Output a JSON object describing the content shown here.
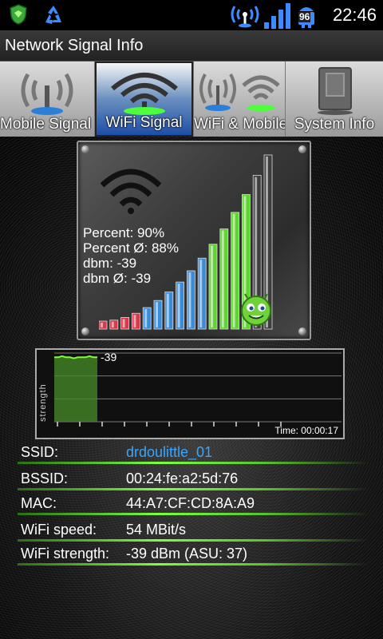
{
  "status_bar": {
    "time": "22:46",
    "battery_level": "96",
    "icons": [
      "shield-icon",
      "recycle-icon",
      "antenna-icon",
      "signal-bars-icon",
      "android-battery-icon"
    ]
  },
  "app": {
    "title": "Network Signal Info"
  },
  "tabs": [
    {
      "label": "Mobile Signal",
      "icon": "antenna-icon",
      "active": false
    },
    {
      "label": "WiFi Signal",
      "icon": "wifi-icon",
      "active": true
    },
    {
      "label": "WiFi & Mobile",
      "icon": "antenna-wifi-icon",
      "active": false
    },
    {
      "label": "System Info",
      "icon": "phone-icon",
      "active": false
    }
  ],
  "signal": {
    "percent": "Percent: 90%",
    "percent_avg": "Percent Ø: 88%",
    "dbm": "dbm: -39",
    "dbm_avg": "dbm Ø: -39",
    "level_fraction": 0.9,
    "bar_count": 16
  },
  "chart_data": {
    "type": "line",
    "ylabel": "strength",
    "value_label": "-39",
    "time_label": "Time: 00:00:17",
    "series": [
      {
        "values": [
          -39,
          -39,
          -38,
          -39,
          -39,
          -40,
          -39,
          -39,
          -39,
          -38,
          -39,
          -39
        ]
      }
    ]
  },
  "info": {
    "rows": [
      {
        "label": "SSID:",
        "value": "drdoulittle_01"
      },
      {
        "label": "BSSID:",
        "value": "00:24:fe:a2:5d:76"
      },
      {
        "label": "MAC:",
        "value": "44:A7:CF:CD:8A:A9"
      },
      {
        "label": "WiFi speed:",
        "value": "54 MBit/s"
      },
      {
        "label": "WiFi strength:",
        "value": "-39 dBm (ASU: 37)"
      }
    ]
  },
  "colors": {
    "accent_green": "#7dff3a",
    "link_blue": "#37a6ff",
    "tab_active": "#1c4fa8"
  }
}
